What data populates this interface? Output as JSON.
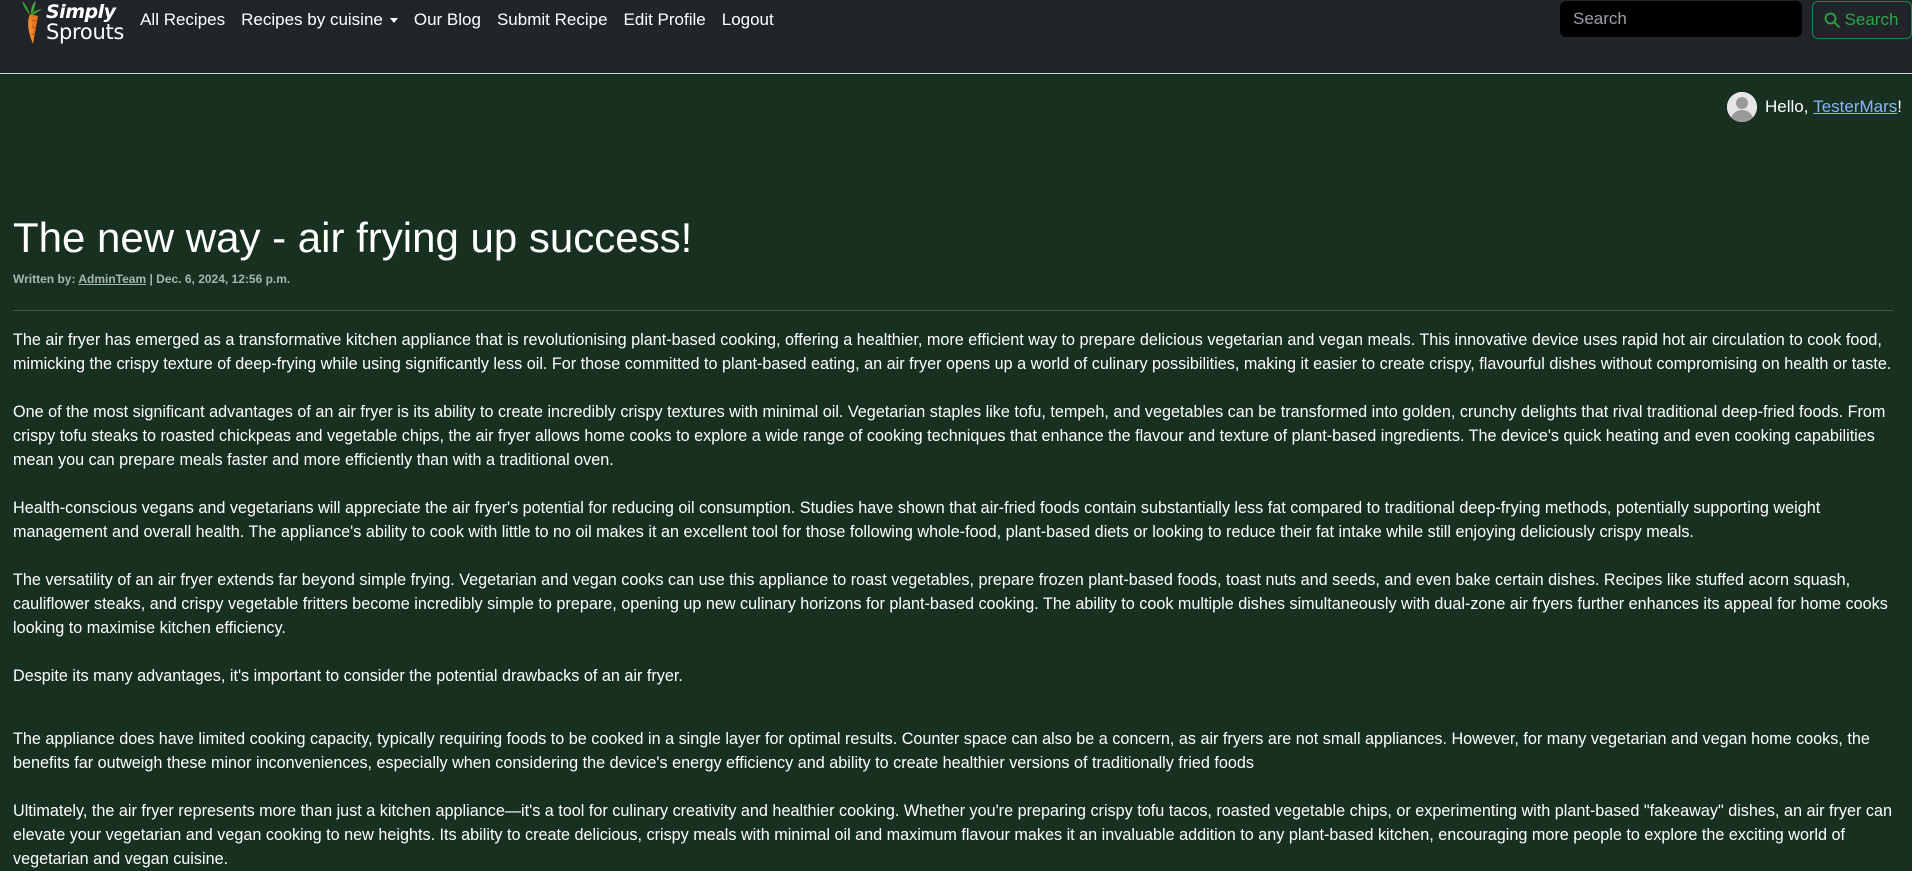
{
  "brand": {
    "line1": "Simply",
    "line2": "Sprouts"
  },
  "nav": {
    "links": [
      "All Recipes",
      "Recipes by cuisine",
      "Our Blog",
      "Submit Recipe",
      "Edit Profile",
      "Logout"
    ]
  },
  "search": {
    "placeholder": "Search",
    "button_label": "Search"
  },
  "greeting": {
    "prefix": "Hello, ",
    "username": "TesterMars",
    "suffix": "!"
  },
  "article": {
    "title": "The new way - air frying up success!",
    "meta_prefix": "Written by: ",
    "author": "AdminTeam",
    "meta_suffix": " | Dec. 6, 2024, 12:56 p.m.",
    "paragraphs": [
      "The air fryer has emerged as a transformative kitchen appliance that is revolutionising plant-based cooking, offering a healthier, more efficient way to prepare delicious vegetarian and vegan meals. This innovative device uses rapid hot air circulation to cook food, mimicking the crispy texture of deep-frying while using significantly less oil. For those committed to plant-based eating, an air fryer opens up a world of culinary possibilities, making it easier to create crispy, flavourful dishes without compromising on health or taste.",
      "One of the most significant advantages of an air fryer is its ability to create incredibly crispy textures with minimal oil. Vegetarian staples like tofu, tempeh, and vegetables can be transformed into golden, crunchy delights that rival traditional deep-fried foods. From crispy tofu steaks to roasted chickpeas and vegetable chips, the air fryer allows home cooks to explore a wide range of cooking techniques that enhance the flavour and texture of plant-based ingredients. The device's quick heating and even cooking capabilities mean you can prepare meals faster and more efficiently than with a traditional oven.",
      "Health-conscious vegans and vegetarians will appreciate the air fryer's potential for reducing oil consumption. Studies have shown that air-fried foods contain substantially less fat compared to traditional deep-frying methods, potentially supporting weight management and overall health. The appliance's ability to cook with little to no oil makes it an excellent tool for those following whole-food, plant-based diets or looking to reduce their fat intake while still enjoying deliciously crispy meals.",
      "The versatility of an air fryer extends far beyond simple frying. Vegetarian and vegan cooks can use this appliance to roast vegetables, prepare frozen plant-based foods, toast nuts and seeds, and even bake certain dishes. Recipes like stuffed acorn squash, cauliflower steaks, and crispy vegetable fritters become incredibly simple to prepare, opening up new culinary horizons for plant-based cooking. The ability to cook multiple dishes simultaneously with dual-zone air fryers further enhances its appeal for home cooks looking to maximise kitchen efficiency.",
      "Despite its many advantages, it's important to consider the potential drawbacks of an air fryer.",
      "The appliance does have limited cooking capacity, typically requiring foods to be cooked in a single layer for optimal results. Counter space can also be a concern, as air fryers are not small appliances. However, for many vegetarian and vegan home cooks, the benefits far outweigh these minor inconveniences, especially when considering the device's energy efficiency and ability to create healthier versions of traditionally fried foods",
      "Ultimately, the air fryer represents more than just a kitchen appliance—it's a tool for culinary creativity and healthier cooking. Whether you're preparing crispy tofu tacos, roasted vegetable chips, or experimenting with plant-based \"fakeaway\" dishes, an air fryer can elevate your vegetarian and vegan cooking to new heights. Its ability to create delicious, crispy meals with minimal oil and maximum flavour makes it an invaluable addition to any plant-based kitchen, encouraging more people to explore the exciting world of vegetarian and vegan cuisine."
    ]
  },
  "colors": {
    "navbar_bg": "#212529",
    "page_bg": "#173020",
    "accent_green": "#28a745",
    "link_blue": "#8ab4f8"
  },
  "icons": {
    "logo": "carrot-icon",
    "search": "search-icon",
    "avatar": "user-avatar-icon",
    "dropdown": "caret-down-icon"
  }
}
